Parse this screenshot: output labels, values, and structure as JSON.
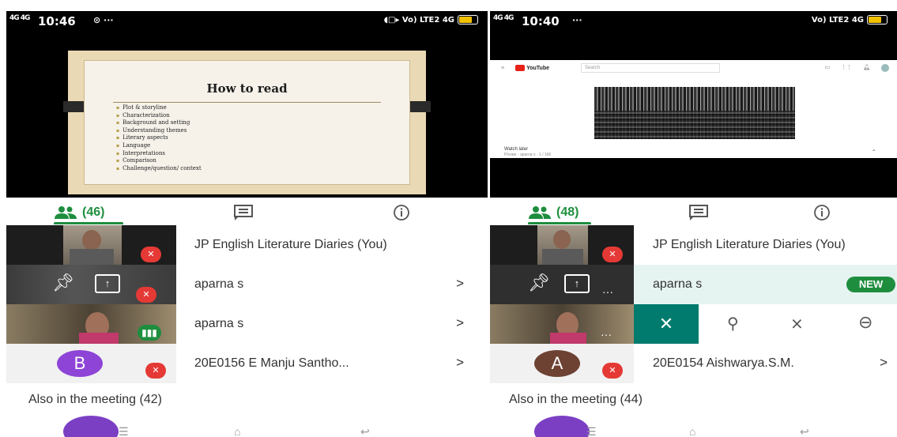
{
  "left": {
    "status": {
      "signal": "4G 4G",
      "time": "10:46",
      "extras": "⊙ ···",
      "right": "◖□▸ Vo) LTE2 4G"
    },
    "slide": {
      "title": "How to read",
      "bullets": [
        "Plot & storyline",
        "Characterization",
        "Background and setting",
        "Understanding themes",
        "Literary aspects",
        "Language",
        "Interpretations",
        "Comparison",
        "Challenge/question/ context"
      ]
    },
    "tabs": {
      "people_count": "(46)"
    },
    "participants": [
      {
        "name": "JP English Literature Diaries (You)",
        "chevron": ""
      },
      {
        "name": "aparna s",
        "chevron": ">"
      },
      {
        "name": "aparna s",
        "chevron": ">"
      },
      {
        "name": "20E0156 E Manju Santho...",
        "chevron": ">",
        "avatar": "B"
      }
    ],
    "also_in": "Also in the meeting (42)"
  },
  "right": {
    "status": {
      "signal": "4G 4G",
      "time": "10:40",
      "extras": "···",
      "right": "Vo) LTE2 4G"
    },
    "youtube": {
      "brand": "YouTube",
      "search_placeholder": "Search",
      "watch_later": "Watch later",
      "watch_meta": "Private · aparna s · 1 / 166"
    },
    "tabs": {
      "people_count": "(48)"
    },
    "participants": [
      {
        "name": "JP English Literature Diaries (You)",
        "chevron": ""
      },
      {
        "name": "aparna s",
        "badge": "NEW"
      },
      {
        "name": "",
        "actions": [
          "close",
          "pin",
          "mute",
          "remove"
        ]
      },
      {
        "name": "20E0154 Aishwarya.S.M.",
        "chevron": ">",
        "avatar": "A"
      }
    ],
    "also_in": "Also in the meeting (44)"
  },
  "colors": {
    "meet_green": "#1e8e3e",
    "mute_red": "#e53935",
    "avatar_b": "#8e44d6",
    "avatar_a": "#6d4232",
    "highlight": "#e6f4f1",
    "action_teal": "#007b6e"
  }
}
